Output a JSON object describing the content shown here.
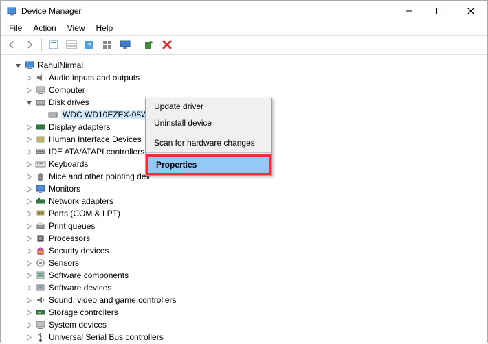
{
  "window": {
    "title": "Device Manager"
  },
  "menus": {
    "file": "File",
    "action": "Action",
    "view": "View",
    "help": "Help"
  },
  "tree": {
    "root": "RahulNirmal",
    "audio": "Audio inputs and outputs",
    "computer": "Computer",
    "disk": "Disk drives",
    "disk_child": "WDC WD10EZEX-08WN4A0",
    "display": "Display adapters",
    "hid": "Human Interface Devices",
    "ide": "IDE ATA/ATAPI controllers",
    "keyboards": "Keyboards",
    "mice": "Mice and other pointing dev",
    "monitors": "Monitors",
    "network": "Network adapters",
    "ports": "Ports (COM & LPT)",
    "printq": "Print queues",
    "processors": "Processors",
    "security": "Security devices",
    "sensors": "Sensors",
    "swcomp": "Software components",
    "swdev": "Software devices",
    "sound": "Sound, video and game controllers",
    "storage": "Storage controllers",
    "system": "System devices",
    "usb": "Universal Serial Bus controllers"
  },
  "context": {
    "update": "Update driver",
    "uninstall": "Uninstall device",
    "scan": "Scan for hardware changes",
    "properties": "Properties"
  }
}
